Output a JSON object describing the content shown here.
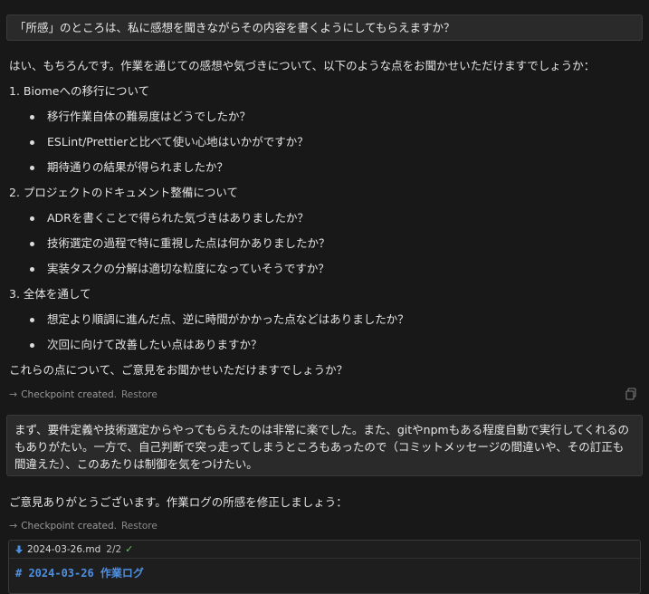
{
  "messages": {
    "user_1": "「所感」のところは、私に感想を聞きながらその内容を書くようにしてもらえますか？",
    "assistant_1": {
      "intro": "はい、もちろんです。作業を通じての感想や気づきについて、以下のような点をお聞かせいただけますでしょうか：",
      "sections": [
        {
          "heading": "1. Biomeへの移行について",
          "bullets": [
            "移行作業自体の難易度はどうでしたか？",
            "ESLint/Prettierと比べて使い心地はいかがですか？",
            "期待通りの結果が得られましたか？"
          ]
        },
        {
          "heading": "2. プロジェクトのドキュメント整備について",
          "bullets": [
            "ADRを書くことで得られた気づきはありましたか？",
            "技術選定の過程で特に重視した点は何かありましたか？",
            "実装タスクの分解は適切な粒度になっていそうですか？"
          ]
        },
        {
          "heading": "3. 全体を通して",
          "bullets": [
            "想定より順調に進んだ点、逆に時間がかかった点などはありましたか？",
            "次回に向けて改善したい点はありますか？"
          ]
        }
      ],
      "outro": "これらの点について、ご意見をお聞かせいただけますでしょうか？"
    },
    "checkpoint_1": {
      "label": "Checkpoint created.",
      "restore": "Restore"
    },
    "user_2": "まず、要件定義や技術選定からやってもらえたのは非常に楽でした。また、gitやnpmもある程度自動で実行してくれるのもありがたい。一方で、自己判断で突っ走ってしまうところもあったので（コミットメッセージの間違いや、その訂正も間違えた）、このあたりは制御を気をつけたい。",
    "assistant_2": "ご意見ありがとうございます。作業ログの所感を修正しましょう：",
    "checkpoint_2": {
      "label": "Checkpoint created.",
      "restore": "Restore"
    },
    "file_edit": {
      "filename": "2024-03-26.md",
      "count": "2/2",
      "code_line": "# 2024-03-26 作業ログ"
    }
  },
  "icons": {
    "checkpoint": "arrow-right-icon",
    "copy": "copy-icon",
    "file": "download-arrow-icon",
    "status": "check-icon"
  },
  "colors": {
    "background": "#181818",
    "bubble": "#2a2a2a",
    "text": "#e3e3e3",
    "muted": "#9a9a9a",
    "code_heading": "#4f8fe0",
    "check": "#6fbf73",
    "file_icon": "#4a90e2"
  }
}
